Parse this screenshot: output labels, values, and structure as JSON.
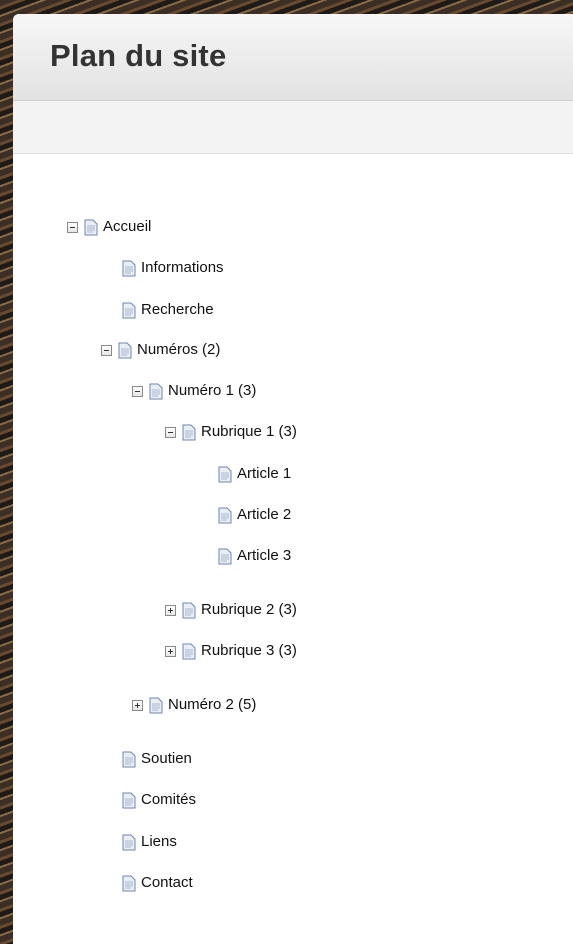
{
  "page": {
    "title": "Plan du site"
  },
  "tree": {
    "accueil": {
      "label": "Accueil",
      "expanded": true
    },
    "informations": {
      "label": "Informations"
    },
    "recherche": {
      "label": "Recherche"
    },
    "numeros": {
      "label": "Numéros (2)",
      "expanded": true
    },
    "numero1": {
      "label": "Numéro 1 (3)",
      "expanded": true
    },
    "rubrique1": {
      "label": "Rubrique 1 (3)",
      "expanded": true
    },
    "article1": {
      "label": "Article 1"
    },
    "article2": {
      "label": "Article 2"
    },
    "article3": {
      "label": "Article 3"
    },
    "rubrique2": {
      "label": "Rubrique 2 (3)",
      "expanded": false
    },
    "rubrique3": {
      "label": "Rubrique 3 (3)",
      "expanded": false
    },
    "numero2": {
      "label": "Numéro 2 (5)",
      "expanded": false
    },
    "soutien": {
      "label": "Soutien"
    },
    "comites": {
      "label": "Comités"
    },
    "liens": {
      "label": "Liens"
    },
    "contact": {
      "label": "Contact"
    }
  },
  "colors": {
    "header_text": "#333333",
    "doc_icon_fill": "#e9eef6",
    "doc_icon_stroke": "#6f86ad"
  }
}
